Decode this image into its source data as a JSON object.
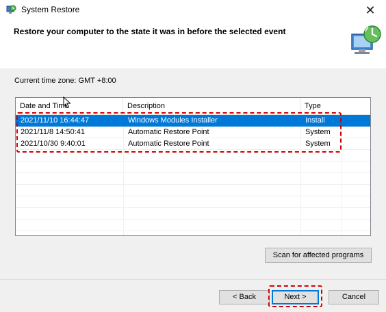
{
  "window": {
    "title": "System Restore",
    "app_icon": "system-restore-icon",
    "close_glyph": "✕"
  },
  "header": {
    "heading": "Restore your computer to the state it was in before the selected event"
  },
  "timezone": {
    "text": "Current time zone: GMT +8:00"
  },
  "table": {
    "columns": [
      "Date and Time",
      "Description",
      "Type"
    ],
    "rows": [
      {
        "date": "2021/11/10 16:44:47",
        "description": "Windows Modules Installer",
        "type": "Install",
        "selected": true
      },
      {
        "date": "2021/11/8 14:50:41",
        "description": "Automatic Restore Point",
        "type": "System",
        "selected": false
      },
      {
        "date": "2021/10/30 9:40:01",
        "description": "Automatic Restore Point",
        "type": "System",
        "selected": false
      }
    ]
  },
  "buttons": {
    "scan": "Scan for affected programs",
    "back": "< Back",
    "next": "Next >",
    "cancel": "Cancel"
  },
  "colors": {
    "selection": "#0078d7",
    "highlight_annotation": "#d00000"
  }
}
